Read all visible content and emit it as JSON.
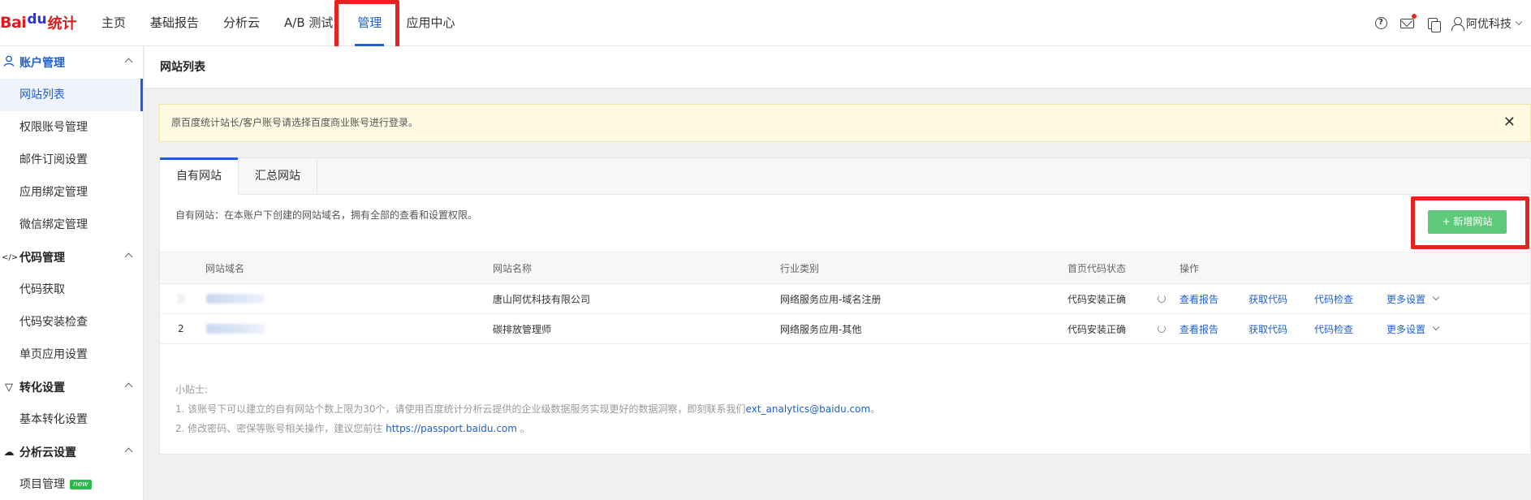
{
  "logo": {
    "part1": "Bai",
    "paw": "du",
    "part2": "统计"
  },
  "nav": {
    "items": [
      {
        "label": "主页"
      },
      {
        "label": "基础报告"
      },
      {
        "label": "分析云"
      },
      {
        "label": "A/B 测试"
      },
      {
        "label": "管理",
        "active": true
      },
      {
        "label": "应用中心"
      }
    ]
  },
  "header_right": {
    "help_icon": "?",
    "user_name": "阿优科技"
  },
  "sidebar": {
    "groups": [
      {
        "title": "账户管理",
        "icon": "user-icon",
        "items": [
          "网站列表",
          "权限账号管理",
          "邮件订阅设置",
          "应用绑定管理",
          "微信绑定管理"
        ]
      },
      {
        "title": "代码管理",
        "icon": "code-icon",
        "glyph": "</>",
        "items": [
          "代码获取",
          "代码安装检查",
          "单页应用设置"
        ]
      },
      {
        "title": "转化设置",
        "icon": "filter-icon",
        "glyph": "▽",
        "items": [
          "基本转化设置"
        ]
      },
      {
        "title": "分析云设置",
        "icon": "cloud-icon",
        "glyph": "☁",
        "items": [
          "项目管理"
        ]
      }
    ],
    "new_badge": "new"
  },
  "page": {
    "title": "网站列表",
    "notice": "原百度统计站长/客户账号请选择百度商业账号进行登录。",
    "close_glyph": "✕",
    "tabs": [
      "自有网站",
      "汇总网站"
    ],
    "description": "自有网站：在本账户下创建的网站域名，拥有全部的查看和设置权限。",
    "add_button": "+ 新增网站"
  },
  "table": {
    "headers": [
      "网站域名",
      "网站名称",
      "行业类别",
      "首页代码状态",
      "操作"
    ],
    "rows": [
      {
        "index": "",
        "name": "唐山阿优科技有限公司",
        "industry": "网络服务应用-域名注册",
        "status": "代码安装正确"
      },
      {
        "index": "2",
        "name": "碳排放管理师",
        "industry": "网络服务应用-其他",
        "status": "代码安装正确"
      }
    ],
    "actions": [
      "查看报告",
      "获取代码",
      "代码检查",
      "更多设置"
    ]
  },
  "tips": {
    "title": "小贴士:",
    "line1_prefix": "1. 该账号下可以建立的自有网站个数上限为30个，请使用百度统计分析云提供的企业级数据服务实现更好的数据洞察，即刻联系我们",
    "line1_link": "ext_analytics@baidu.com",
    "line1_suffix": "。",
    "line2_prefix": "2. 修改密码、密保等账号相关操作，建议您前往 ",
    "line2_link": "https://passport.baidu.com",
    "line2_suffix": " 。"
  },
  "colors": {
    "accent": "#1f5fd1",
    "highlight": "#e8221f",
    "add_button": "#5fc97a",
    "notice_bg": "#fffbe3"
  }
}
